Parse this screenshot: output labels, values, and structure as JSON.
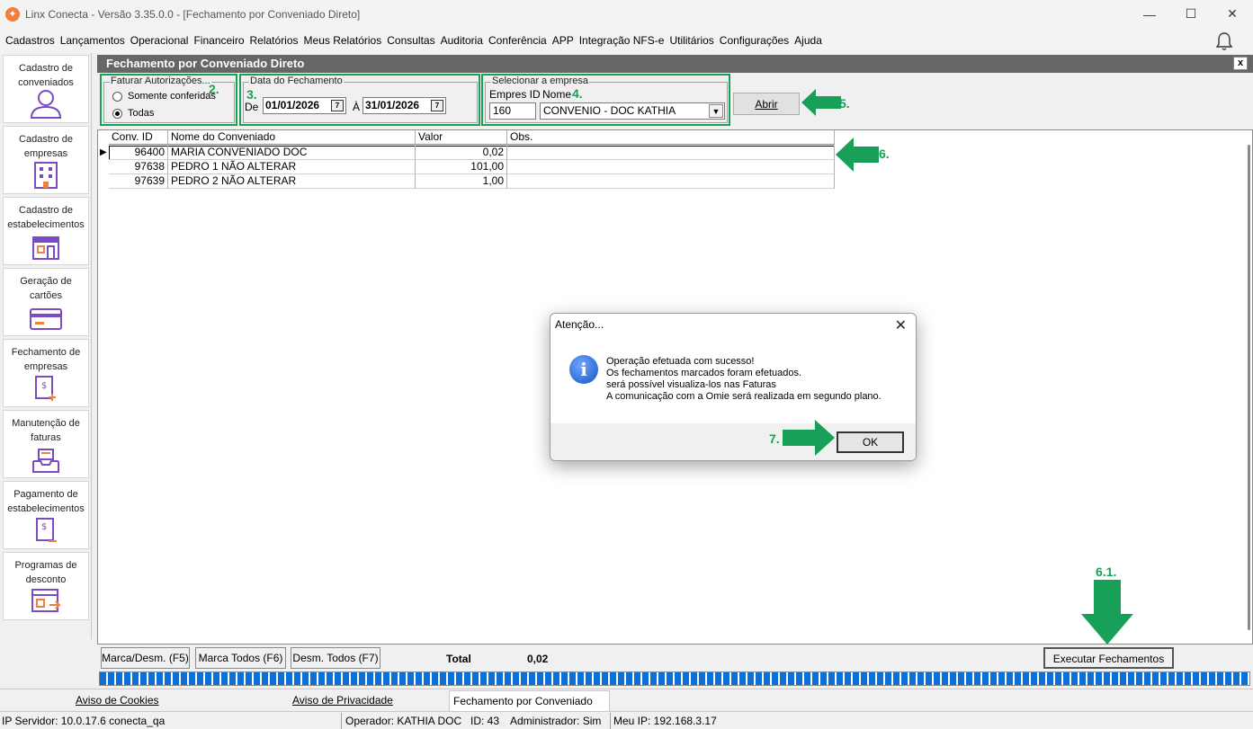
{
  "window": {
    "title": "Linx Conecta - Versão 3.35.0.0 - [Fechamento por Conveniado Direto]",
    "controls": [
      "—",
      "☐",
      "✕"
    ]
  },
  "menu": [
    "Cadastros",
    "Lançamentos",
    "Operacional",
    "Financeiro",
    "Relatórios",
    "Meus Relatórios",
    "Consultas",
    "Auditoria",
    "Conferência",
    "APP",
    "Integração NFS-e",
    "Utilitários",
    "Configurações",
    "Ajuda"
  ],
  "sidebar": [
    {
      "label": "Cadastro de conveniados",
      "icon": "user-icon"
    },
    {
      "label": "Cadastro de empresas",
      "icon": "building-icon"
    },
    {
      "label": "Cadastro de estabelecimentos",
      "icon": "store-icon"
    },
    {
      "label": "Geração de cartões",
      "icon": "card-icon"
    },
    {
      "label": "Fechamento de empresas",
      "icon": "invoice-add-icon"
    },
    {
      "label": "Manutenção de faturas",
      "icon": "inbox-tray-icon"
    },
    {
      "label": "Pagamento de estabelecimentos",
      "icon": "payment-icon"
    },
    {
      "label": "Programas de desconto",
      "icon": "discount-program-icon"
    }
  ],
  "form": {
    "title": "Fechamento por Conveniado Direto",
    "close": "x",
    "faturar": {
      "legend": "Faturar Autorizações...",
      "option1": "Somente conferidas",
      "option2": "Todas",
      "selected": "Todas"
    },
    "data": {
      "legend": "Data do Fechamento",
      "de_label": "De",
      "de": "01/01/2026",
      "ate_label": "À",
      "ate": "31/01/2026"
    },
    "empresa": {
      "legend": "Selecionar a empresa",
      "id_label": "Empres ID",
      "nome_label": "Nome",
      "id": "160",
      "nome": "CONVENIO -  DOC KATHIA"
    },
    "abrir": "Abrir"
  },
  "annotations": {
    "a2": "2.",
    "a3": "3.",
    "a4": "4.",
    "a5": "5.",
    "a6": "6.",
    "a61": "6.1.",
    "a7": "7."
  },
  "grid": {
    "headers": [
      "Conv. ID",
      "Nome do Conveniado",
      "Valor",
      "Obs."
    ],
    "rows": [
      {
        "id": "96400",
        "nome": "MARIA CONVENIADO DOC",
        "valor": "0,02",
        "obs": ""
      },
      {
        "id": "97638",
        "nome": "PEDRO 1 NÃO ALTERAR",
        "valor": "101,00",
        "obs": ""
      },
      {
        "id": "97639",
        "nome": "PEDRO 2 NÃO ALTERAR",
        "valor": "1,00",
        "obs": ""
      }
    ]
  },
  "footer": {
    "marca": "Marca/Desm. (F5)",
    "marca_todos": "Marca Todos (F6)",
    "desm_todos": "Desm. Todos (F7)",
    "total_label": "Total",
    "total_value": "0,02",
    "executar": "Executar Fechamentos"
  },
  "tabs": {
    "cookies": "Aviso de Cookies",
    "privacidade": "Aviso de Privacidade",
    "active": "Fechamento por Conveniado Direto"
  },
  "status": {
    "servidor": "IP Servidor: 10.0.17.6 conecta_qa",
    "operador": "Operador: KATHIA DOC",
    "id": "ID: 43",
    "admin": "Administrador: Sim",
    "meu_ip": "Meu IP: 192.168.3.17"
  },
  "dialog": {
    "title": "Atenção...",
    "close": "✕",
    "lines": [
      "Operação efetuada com sucesso!",
      "Os fechamentos marcados foram efetuados.",
      "será possível visualiza-los nas Faturas",
      "A comunicação com a Omie será realizada em segundo plano."
    ],
    "ok": "OK",
    "icon_glyph": "i"
  },
  "colors": {
    "accent_green": "#19a058",
    "progress_blue": "#0a6fd6",
    "title_gray": "#666666"
  }
}
